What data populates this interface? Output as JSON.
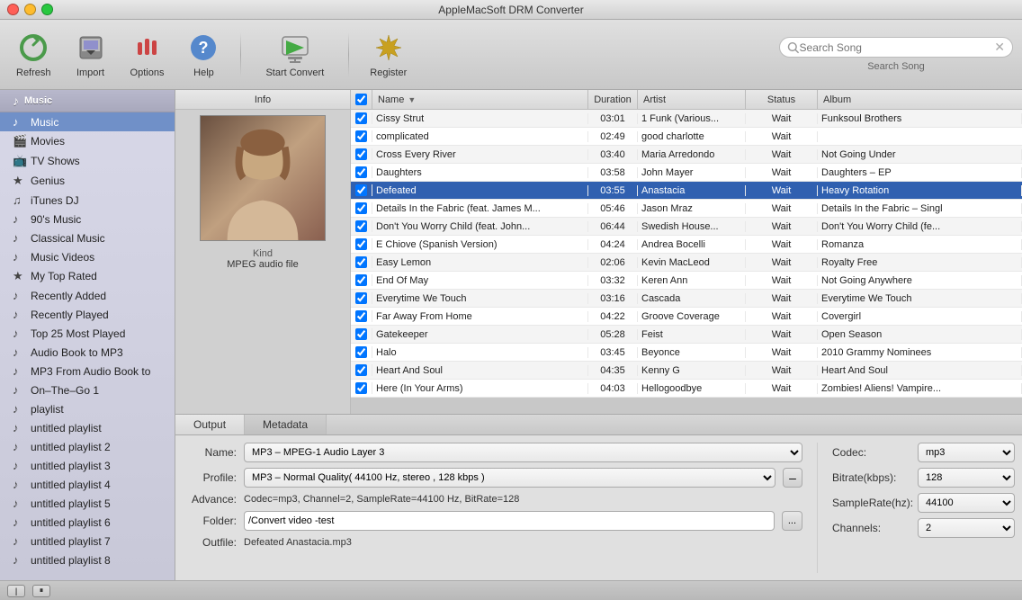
{
  "window": {
    "title": "AppleMacSoft DRM Converter"
  },
  "toolbar": {
    "refresh_label": "Refresh",
    "import_label": "Import",
    "options_label": "Options",
    "help_label": "Help",
    "start_convert_label": "Start Convert",
    "register_label": "Register",
    "search_placeholder": "Search Song",
    "search_label": "Search Song"
  },
  "sidebar": {
    "section_label": "Music",
    "items": [
      {
        "id": "music",
        "label": "Music",
        "icon": "♪",
        "active": true
      },
      {
        "id": "movies",
        "label": "Movies",
        "icon": "🎬"
      },
      {
        "id": "tv-shows",
        "label": "TV Shows",
        "icon": "📺"
      },
      {
        "id": "genius",
        "label": "Genius",
        "icon": "★"
      },
      {
        "id": "itunes-dj",
        "label": "iTunes DJ",
        "icon": "♫"
      },
      {
        "id": "90s-music",
        "label": "90's Music",
        "icon": "♪"
      },
      {
        "id": "classical",
        "label": "Classical Music",
        "icon": "♪"
      },
      {
        "id": "music-videos",
        "label": "Music Videos",
        "icon": "♪"
      },
      {
        "id": "my-top-rated",
        "label": "My Top Rated",
        "icon": "★"
      },
      {
        "id": "recently-added",
        "label": "Recently Added",
        "icon": "♪"
      },
      {
        "id": "recently-played",
        "label": "Recently Played",
        "icon": "♪"
      },
      {
        "id": "top-25",
        "label": "Top 25 Most Played",
        "icon": "♪"
      },
      {
        "id": "audiobook",
        "label": "Audio Book to MP3",
        "icon": "♪"
      },
      {
        "id": "mp3-from-audio",
        "label": "MP3 From Audio Book to",
        "icon": "♪"
      },
      {
        "id": "on-the-go",
        "label": "On–The–Go 1",
        "icon": "♪"
      },
      {
        "id": "playlist",
        "label": "playlist",
        "icon": "♪"
      },
      {
        "id": "untitled-1",
        "label": "untitled playlist",
        "icon": "♪"
      },
      {
        "id": "untitled-2",
        "label": "untitled playlist 2",
        "icon": "♪"
      },
      {
        "id": "untitled-3",
        "label": "untitled playlist 3",
        "icon": "♪"
      },
      {
        "id": "untitled-4",
        "label": "untitled playlist 4",
        "icon": "♪"
      },
      {
        "id": "untitled-5",
        "label": "untitled playlist 5",
        "icon": "♪"
      },
      {
        "id": "untitled-6",
        "label": "untitled playlist 6",
        "icon": "♪"
      },
      {
        "id": "untitled-7",
        "label": "untitled playlist 7",
        "icon": "♪"
      },
      {
        "id": "untitled-8",
        "label": "untitled playlist 8",
        "icon": "♪"
      }
    ]
  },
  "table": {
    "headers": {
      "info": "Info",
      "name": "Name",
      "duration": "Duration",
      "artist": "Artist",
      "status": "Status",
      "album": "Album"
    },
    "rows": [
      {
        "checked": true,
        "name": "Cissy Strut",
        "duration": "03:01",
        "artist": "1 Funk (Various...",
        "status": "Wait",
        "album": "Funksoul Brothers",
        "selected": false
      },
      {
        "checked": true,
        "name": "complicated",
        "duration": "02:49",
        "artist": "good charlotte",
        "status": "Wait",
        "album": "",
        "selected": false
      },
      {
        "checked": true,
        "name": "Cross Every River",
        "duration": "03:40",
        "artist": "Maria Arredondo",
        "status": "Wait",
        "album": "Not Going Under",
        "selected": false
      },
      {
        "checked": true,
        "name": "Daughters",
        "duration": "03:58",
        "artist": "John Mayer",
        "status": "Wait",
        "album": "Daughters – EP",
        "selected": false
      },
      {
        "checked": true,
        "name": "Defeated",
        "duration": "03:55",
        "artist": "Anastacia",
        "status": "Wait",
        "album": "Heavy Rotation",
        "selected": true
      },
      {
        "checked": true,
        "name": "Details In the Fabric (feat. James M...",
        "duration": "05:46",
        "artist": "Jason Mraz",
        "status": "Wait",
        "album": "Details In the Fabric – Singl",
        "selected": false
      },
      {
        "checked": true,
        "name": "Don't You Worry Child (feat. John...",
        "duration": "06:44",
        "artist": "Swedish House...",
        "status": "Wait",
        "album": "Don't You Worry Child (fe...",
        "selected": false
      },
      {
        "checked": true,
        "name": "E Chiove (Spanish Version)",
        "duration": "04:24",
        "artist": "Andrea Bocelli",
        "status": "Wait",
        "album": "Romanza",
        "selected": false
      },
      {
        "checked": true,
        "name": "Easy Lemon",
        "duration": "02:06",
        "artist": "Kevin MacLeod",
        "status": "Wait",
        "album": "Royalty Free",
        "selected": false
      },
      {
        "checked": true,
        "name": "End Of May",
        "duration": "03:32",
        "artist": "Keren Ann",
        "status": "Wait",
        "album": "Not Going Anywhere",
        "selected": false
      },
      {
        "checked": true,
        "name": "Everytime We Touch",
        "duration": "03:16",
        "artist": "Cascada",
        "status": "Wait",
        "album": "Everytime We Touch",
        "selected": false
      },
      {
        "checked": true,
        "name": "Far Away From Home",
        "duration": "04:22",
        "artist": "Groove Coverage",
        "status": "Wait",
        "album": "Covergirl",
        "selected": false
      },
      {
        "checked": true,
        "name": "Gatekeeper",
        "duration": "05:28",
        "artist": "Feist",
        "status": "Wait",
        "album": "Open Season",
        "selected": false
      },
      {
        "checked": true,
        "name": "Halo",
        "duration": "03:45",
        "artist": "Beyonce",
        "status": "Wait",
        "album": "2010 Grammy Nominees",
        "selected": false
      },
      {
        "checked": true,
        "name": "Heart And Soul",
        "duration": "04:35",
        "artist": "Kenny G",
        "status": "Wait",
        "album": "Heart And Soul",
        "selected": false
      },
      {
        "checked": true,
        "name": "Here (In Your Arms)",
        "duration": "04:03",
        "artist": "Hellogoodbye",
        "status": "Wait",
        "album": "Zombies! Aliens! Vampire...",
        "selected": false
      }
    ]
  },
  "info_panel": {
    "kind_label": "Kind",
    "kind_value": "MPEG audio file"
  },
  "bottom": {
    "tabs": [
      "Output",
      "Metadata"
    ],
    "active_tab": "Output",
    "form": {
      "name_label": "Name:",
      "name_value": "MP3 – MPEG-1 Audio Layer 3",
      "profile_label": "Profile:",
      "profile_value": "MP3 – Normal Quality( 44100 Hz, stereo , 128 kbps )",
      "advance_label": "Advance:",
      "advance_value": "Codec=mp3, Channel=2, SampleRate=44100 Hz, BitRate=128",
      "folder_label": "Folder:",
      "folder_value": "/Convert video -test",
      "outfile_label": "Outfile:",
      "outfile_value": "Defeated Anastacia.mp3"
    },
    "codec": {
      "codec_label": "Codec:",
      "codec_value": "mp3",
      "bitrate_label": "Bitrate(kbps):",
      "bitrate_value": "128",
      "samplerate_label": "SampleRate(hz):",
      "samplerate_value": "44100",
      "channels_label": "Channels:",
      "channels_value": "2"
    }
  }
}
